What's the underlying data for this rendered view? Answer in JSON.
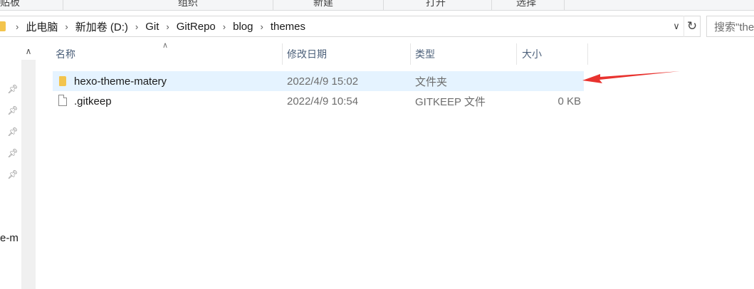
{
  "ribbon": {
    "groups": [
      "贴板",
      "组织",
      "新建",
      "打开",
      "选择"
    ]
  },
  "address": {
    "crumbs": [
      "此电脑",
      "新加卷 (D:)",
      "Git",
      "GitRepo",
      "blog",
      "themes"
    ]
  },
  "search": {
    "placeholder": "搜索\"the"
  },
  "nav": {
    "partial_label": "e-m"
  },
  "columns": {
    "name": "名称",
    "date": "修改日期",
    "type": "类型",
    "size": "大小"
  },
  "files": [
    {
      "name": "hexo-theme-matery",
      "date": "2022/4/9 15:02",
      "type": "文件夹",
      "size": "",
      "kind": "folder",
      "selected": true
    },
    {
      "name": ".gitkeep",
      "date": "2022/4/9 10:54",
      "type": "GITKEEP 文件",
      "size": "0 KB",
      "kind": "file",
      "selected": false
    }
  ],
  "annotation": {
    "arrow_color": "#e8332f"
  }
}
